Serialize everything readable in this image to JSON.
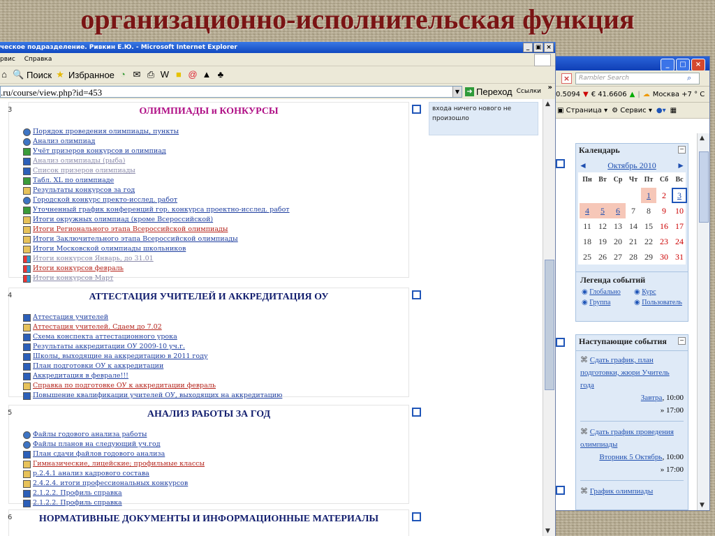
{
  "slide_title": "организационно-исполнительская функция",
  "window": {
    "title": "ческое подразделение. Ривкин Е.Ю. - Microsoft Internet Explorer",
    "controls": [
      "_",
      "Ɖ",
      "×"
    ],
    "menu": [
      "рвис",
      "Справка"
    ],
    "toolbar": {
      "search": "Поиск",
      "favorites": "Избранное"
    },
    "address": ".ru/course/view.php?id=453",
    "go": "Переход",
    "links": "Ссылки",
    "chevron": "»"
  },
  "side_note": {
    "line1": "входа ничего нового не",
    "line2": "произошло"
  },
  "sections": [
    {
      "num": "3",
      "title": "ОЛИМПИАДЫ и КОНКУРСЫ",
      "items": [
        {
          "text": "Порядок проведения олимпиады, пункты",
          "icon": "web",
          "color": "normal"
        },
        {
          "text": "Анализ олимпиад",
          "icon": "web",
          "color": "normal"
        },
        {
          "text": "Учёт призеров конкурсов и олимпиад",
          "icon": "xls",
          "color": "normal"
        },
        {
          "text": "Анализ олимпиады (рыба)",
          "icon": "doc",
          "color": "gray"
        },
        {
          "text": "Список призеров олимпиады",
          "icon": "doc",
          "color": "gray"
        },
        {
          "text": "Табл. XL по олимпиаде",
          "icon": "xls",
          "color": "normal"
        },
        {
          "text": "Результаты конкурсов за год",
          "icon": "folder",
          "color": "normal"
        },
        {
          "text": "Городской конкурс пректо-исслед. работ",
          "icon": "web",
          "color": "normal"
        },
        {
          "text": "Уточненный график конференций гор. конкурса проектно-исслед. работ",
          "icon": "xls",
          "color": "normal"
        },
        {
          "text": "Итоги окружных олимпиад (кроме Всероссийской)",
          "icon": "folder",
          "color": "normal"
        },
        {
          "text": "Итоги Регионального этапа Всероссийской олимпиады",
          "icon": "folder",
          "color": "red"
        },
        {
          "text": "Итоги Заключительного этапа Всероссийской олимпиады",
          "icon": "folder",
          "color": "normal"
        },
        {
          "text": "Итоги Московской олимпиады школьников",
          "icon": "folder",
          "color": "normal"
        },
        {
          "text": "Итоги конкурсов Январь, до 31.01",
          "icon": "img",
          "color": "gray"
        },
        {
          "text": "Итоги конкурсов февраль",
          "icon": "img",
          "color": "red"
        },
        {
          "text": "Итоги конкурсов Март",
          "icon": "img",
          "color": "gray"
        }
      ]
    },
    {
      "num": "4",
      "title": "АТТЕСТАЦИЯ УЧИТЕЛЕЙ И АККРЕДИТАЦИЯ ОУ",
      "items": [
        {
          "text": "Аттестация учителей",
          "icon": "doc",
          "color": "normal"
        },
        {
          "text": "Аттестация учителей. Сдаем до 7.02",
          "icon": "folder",
          "color": "red"
        },
        {
          "text": "Схема конспекта аттестационного урока",
          "icon": "doc",
          "color": "normal"
        },
        {
          "text": "Результаты аккредитации ОУ 2009-10 уч.г.",
          "icon": "doc",
          "color": "normal"
        },
        {
          "text": "Школы, выходящие на аккредитацию в 2011 году",
          "icon": "doc",
          "color": "normal"
        },
        {
          "text": "План подготовки ОУ к аккредитации",
          "icon": "doc",
          "color": "normal"
        },
        {
          "text": "Аккредитация в феврале!!!",
          "icon": "doc",
          "color": "normal"
        },
        {
          "text": "Справка по подготовке ОУ к аккредитации февраль",
          "icon": "folder",
          "color": "red"
        },
        {
          "text": "Повышение квалификации учителей ОУ, выходящих на аккредитацию",
          "icon": "doc",
          "color": "normal"
        }
      ]
    },
    {
      "num": "5",
      "title": "АНАЛИЗ РАБОТЫ ЗА ГОД",
      "items": [
        {
          "text": "Файлы годового анализа работы",
          "icon": "web",
          "color": "normal"
        },
        {
          "text": "Файлы планов на следующий уч.год",
          "icon": "web",
          "color": "normal"
        },
        {
          "text": "План сдачи файлов годового анализа",
          "icon": "doc",
          "color": "normal"
        },
        {
          "text": "Гимназические, лицейские; профильные классы",
          "icon": "folder",
          "color": "red"
        },
        {
          "text": "р.2.4.1 анализ кадрового состава",
          "icon": "folder",
          "color": "normal"
        },
        {
          "text": "2.4.2.4. итоги профессиональных конкурсов",
          "icon": "folder",
          "color": "normal"
        },
        {
          "text": "2.1.2.2. Профиль справка",
          "icon": "doc",
          "color": "normal"
        },
        {
          "text": "2.1.2.2. Профиль справка",
          "icon": "doc",
          "color": "normal"
        }
      ]
    },
    {
      "num": "6",
      "title": "НОРМАТИВНЫЕ ДОКУМЕНТЫ И ИНФОРМАЦИОННЫЕ МАТЕРИАЛЫ",
      "items": []
    }
  ],
  "win2": {
    "search_placeholder": "Rambler Search",
    "ticker": {
      "usd": "0.5094",
      "eur": "€ 41.6606",
      "weather": "Москва +7 ° С"
    },
    "menu": {
      "page": "Страница",
      "service": "Сервис"
    }
  },
  "calendar": {
    "title": "Календарь",
    "month": "Октябрь 2010",
    "prev": "◄",
    "next": "►",
    "days": [
      "Пн",
      "Вт",
      "Ср",
      "Чт",
      "Пт",
      "Сб",
      "Вс"
    ],
    "cells": [
      "",
      "",
      "",
      "",
      "1",
      "2",
      "3",
      "4",
      "5",
      "6",
      "7",
      "8",
      "9",
      "10",
      "11",
      "12",
      "13",
      "14",
      "15",
      "16",
      "17",
      "18",
      "19",
      "20",
      "21",
      "22",
      "23",
      "24",
      "25",
      "26",
      "27",
      "28",
      "29",
      "30",
      "31"
    ],
    "event_days": [
      "1",
      "4",
      "5",
      "6"
    ],
    "weekend_days": [
      "2",
      "9",
      "10",
      "16",
      "17",
      "23",
      "24",
      "30",
      "31"
    ],
    "today": "3"
  },
  "legend": {
    "title": "Легенда событий",
    "items": [
      "Глобально",
      "Курс",
      "Группа",
      "Пользователь"
    ]
  },
  "upcoming": {
    "title": "Наступающие события",
    "events": [
      {
        "link": "Сдать график, план подготовки, жюри Учитель года",
        "day": "Завтра",
        "time_from": "10:00",
        "time_to": "» 17:00"
      },
      {
        "link": "Сдать график проведения олимпиады",
        "day": "Вторник 5 Октябрь",
        "time_from": "10:00",
        "time_to": "» 17:00"
      },
      {
        "link": "График олимпиады",
        "day": "",
        "time_from": "",
        "time_to": ""
      }
    ]
  }
}
